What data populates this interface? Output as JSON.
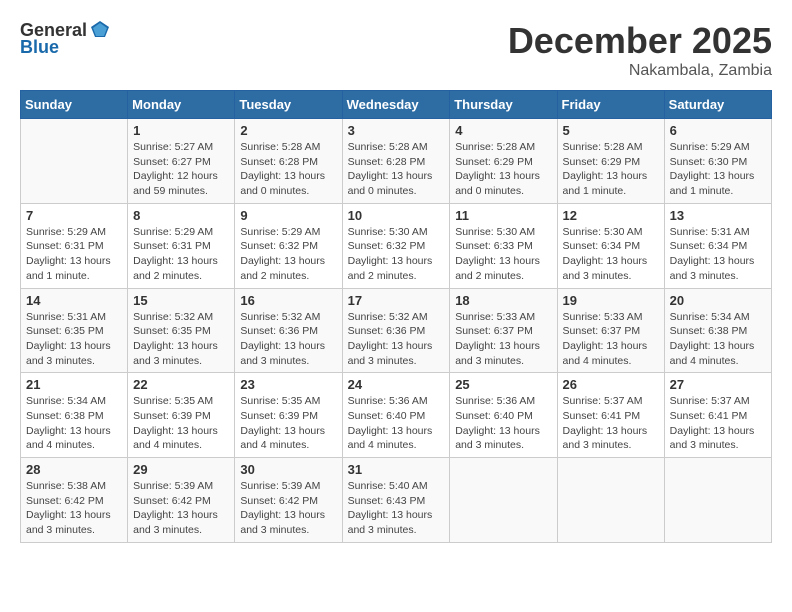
{
  "header": {
    "logo_general": "General",
    "logo_blue": "Blue",
    "month": "December 2025",
    "location": "Nakambala, Zambia"
  },
  "days_of_week": [
    "Sunday",
    "Monday",
    "Tuesday",
    "Wednesday",
    "Thursday",
    "Friday",
    "Saturday"
  ],
  "weeks": [
    [
      {
        "day": "",
        "content": ""
      },
      {
        "day": "1",
        "content": "Sunrise: 5:27 AM\nSunset: 6:27 PM\nDaylight: 12 hours\nand 59 minutes."
      },
      {
        "day": "2",
        "content": "Sunrise: 5:28 AM\nSunset: 6:28 PM\nDaylight: 13 hours\nand 0 minutes."
      },
      {
        "day": "3",
        "content": "Sunrise: 5:28 AM\nSunset: 6:28 PM\nDaylight: 13 hours\nand 0 minutes."
      },
      {
        "day": "4",
        "content": "Sunrise: 5:28 AM\nSunset: 6:29 PM\nDaylight: 13 hours\nand 0 minutes."
      },
      {
        "day": "5",
        "content": "Sunrise: 5:28 AM\nSunset: 6:29 PM\nDaylight: 13 hours\nand 1 minute."
      },
      {
        "day": "6",
        "content": "Sunrise: 5:29 AM\nSunset: 6:30 PM\nDaylight: 13 hours\nand 1 minute."
      }
    ],
    [
      {
        "day": "7",
        "content": "Sunrise: 5:29 AM\nSunset: 6:31 PM\nDaylight: 13 hours\nand 1 minute."
      },
      {
        "day": "8",
        "content": "Sunrise: 5:29 AM\nSunset: 6:31 PM\nDaylight: 13 hours\nand 2 minutes."
      },
      {
        "day": "9",
        "content": "Sunrise: 5:29 AM\nSunset: 6:32 PM\nDaylight: 13 hours\nand 2 minutes."
      },
      {
        "day": "10",
        "content": "Sunrise: 5:30 AM\nSunset: 6:32 PM\nDaylight: 13 hours\nand 2 minutes."
      },
      {
        "day": "11",
        "content": "Sunrise: 5:30 AM\nSunset: 6:33 PM\nDaylight: 13 hours\nand 2 minutes."
      },
      {
        "day": "12",
        "content": "Sunrise: 5:30 AM\nSunset: 6:34 PM\nDaylight: 13 hours\nand 3 minutes."
      },
      {
        "day": "13",
        "content": "Sunrise: 5:31 AM\nSunset: 6:34 PM\nDaylight: 13 hours\nand 3 minutes."
      }
    ],
    [
      {
        "day": "14",
        "content": "Sunrise: 5:31 AM\nSunset: 6:35 PM\nDaylight: 13 hours\nand 3 minutes."
      },
      {
        "day": "15",
        "content": "Sunrise: 5:32 AM\nSunset: 6:35 PM\nDaylight: 13 hours\nand 3 minutes."
      },
      {
        "day": "16",
        "content": "Sunrise: 5:32 AM\nSunset: 6:36 PM\nDaylight: 13 hours\nand 3 minutes."
      },
      {
        "day": "17",
        "content": "Sunrise: 5:32 AM\nSunset: 6:36 PM\nDaylight: 13 hours\nand 3 minutes."
      },
      {
        "day": "18",
        "content": "Sunrise: 5:33 AM\nSunset: 6:37 PM\nDaylight: 13 hours\nand 3 minutes."
      },
      {
        "day": "19",
        "content": "Sunrise: 5:33 AM\nSunset: 6:37 PM\nDaylight: 13 hours\nand 4 minutes."
      },
      {
        "day": "20",
        "content": "Sunrise: 5:34 AM\nSunset: 6:38 PM\nDaylight: 13 hours\nand 4 minutes."
      }
    ],
    [
      {
        "day": "21",
        "content": "Sunrise: 5:34 AM\nSunset: 6:38 PM\nDaylight: 13 hours\nand 4 minutes."
      },
      {
        "day": "22",
        "content": "Sunrise: 5:35 AM\nSunset: 6:39 PM\nDaylight: 13 hours\nand 4 minutes."
      },
      {
        "day": "23",
        "content": "Sunrise: 5:35 AM\nSunset: 6:39 PM\nDaylight: 13 hours\nand 4 minutes."
      },
      {
        "day": "24",
        "content": "Sunrise: 5:36 AM\nSunset: 6:40 PM\nDaylight: 13 hours\nand 4 minutes."
      },
      {
        "day": "25",
        "content": "Sunrise: 5:36 AM\nSunset: 6:40 PM\nDaylight: 13 hours\nand 3 minutes."
      },
      {
        "day": "26",
        "content": "Sunrise: 5:37 AM\nSunset: 6:41 PM\nDaylight: 13 hours\nand 3 minutes."
      },
      {
        "day": "27",
        "content": "Sunrise: 5:37 AM\nSunset: 6:41 PM\nDaylight: 13 hours\nand 3 minutes."
      }
    ],
    [
      {
        "day": "28",
        "content": "Sunrise: 5:38 AM\nSunset: 6:42 PM\nDaylight: 13 hours\nand 3 minutes."
      },
      {
        "day": "29",
        "content": "Sunrise: 5:39 AM\nSunset: 6:42 PM\nDaylight: 13 hours\nand 3 minutes."
      },
      {
        "day": "30",
        "content": "Sunrise: 5:39 AM\nSunset: 6:42 PM\nDaylight: 13 hours\nand 3 minutes."
      },
      {
        "day": "31",
        "content": "Sunrise: 5:40 AM\nSunset: 6:43 PM\nDaylight: 13 hours\nand 3 minutes."
      },
      {
        "day": "",
        "content": ""
      },
      {
        "day": "",
        "content": ""
      },
      {
        "day": "",
        "content": ""
      }
    ]
  ]
}
